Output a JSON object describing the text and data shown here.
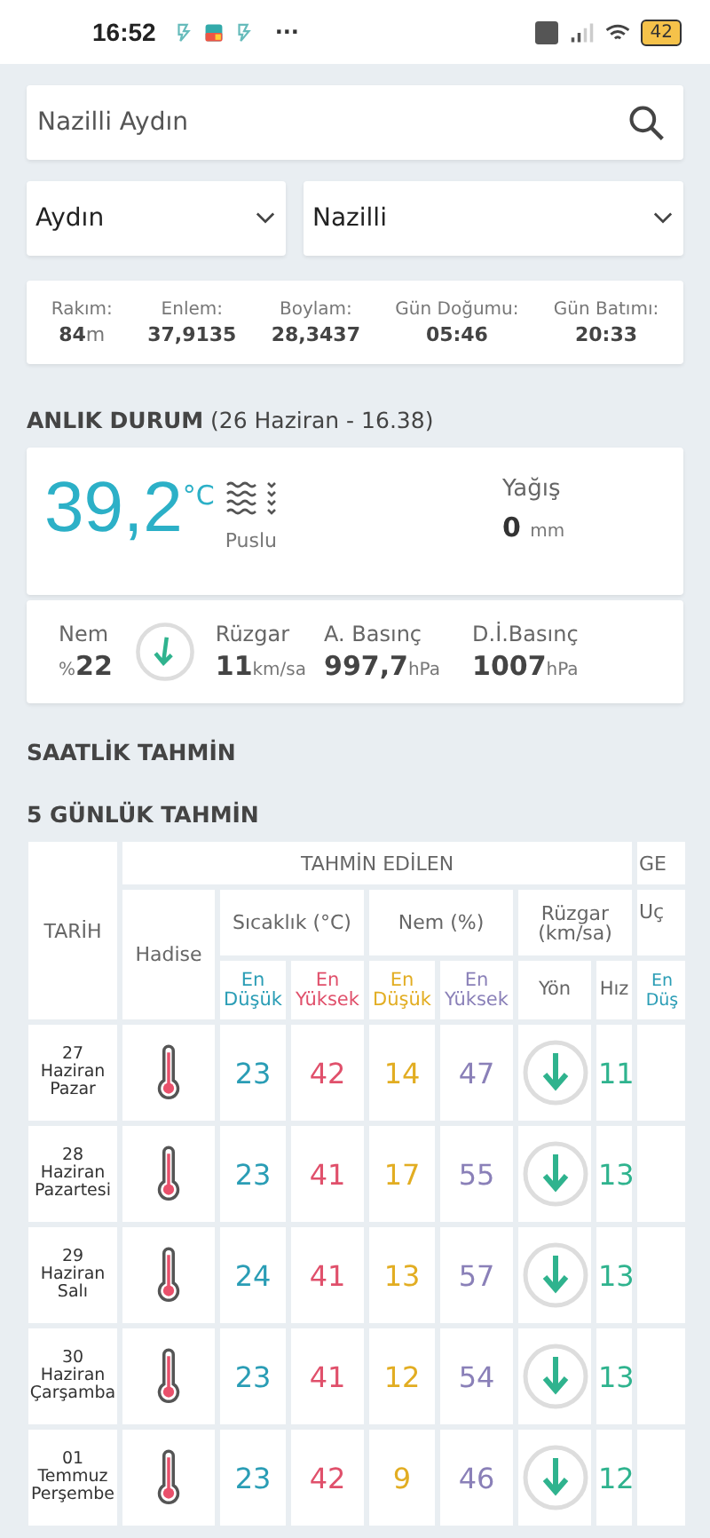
{
  "status_bar": {
    "time": "16:52",
    "more": "···",
    "battery": "42"
  },
  "search": {
    "value": "Nazilli Aydın"
  },
  "selects": [
    {
      "value": "Aydın"
    },
    {
      "value": "Nazilli"
    }
  ],
  "location_info": [
    {
      "label": "Rakım:",
      "value": "84",
      "unit": "m"
    },
    {
      "label": "Enlem:",
      "value": "37,9135"
    },
    {
      "label": "Boylam:",
      "value": "28,3437"
    },
    {
      "label": "Gün Doğumu:",
      "value": "05:46"
    },
    {
      "label": "Gün Batımı:",
      "value": "20:33"
    }
  ],
  "current": {
    "heading": "**ANLIK DURUM** (26 Haziran - 16.38)",
    "temperature": "39,2",
    "temperature_unit": "°C",
    "condition": "Puslu",
    "precip_label": "Yağış",
    "precip_value": "0",
    "precip_unit": "mm",
    "details": [
      {
        "kind": "humidity",
        "label": "Nem",
        "prefix": "%",
        "value": "22"
      },
      {
        "kind": "wind",
        "label": "Rüzgar",
        "value": "11",
        "unit": "km/sa"
      },
      {
        "kind": "pressure",
        "label": "A. Basınç",
        "value": "997,7",
        "unit": "hPa"
      },
      {
        "kind": "pressure",
        "label": "D.İ.Basınç",
        "value": "1007",
        "unit": "hPa"
      }
    ]
  },
  "hourly_heading": "SAATLİK TAHMİN",
  "daily_heading": "5 GÜNLÜK TAHMİN",
  "forecast_table": {
    "date_header": "TARİH",
    "group_header": "TAHMİN EDİLEN",
    "next_group_header": "GE",
    "event_header": "Hadise",
    "temp_header": "Sıcaklık (°C)",
    "humidity_header": "Nem (%)",
    "wind_header": "Rüzgar (km/sa)",
    "next_header": "Uç",
    "sub_headers": [
      {
        "kind": "temp_low",
        "text": "En Düşük"
      },
      {
        "kind": "temp_high",
        "text": "En Yüksek"
      },
      {
        "kind": "hum_low",
        "text": "En Düşük"
      },
      {
        "kind": "hum_high",
        "text": "En Yüksek"
      },
      {
        "kind": "plain",
        "text": "Yön"
      },
      {
        "kind": "plain",
        "text": "Hız"
      },
      {
        "kind": "temp_low",
        "text": "En Düş"
      }
    ],
    "rows": [
      {
        "date": [
          "27",
          "Haziran",
          "Pazar"
        ],
        "temp_low": "23",
        "temp_high": "42",
        "hum_low": "14",
        "hum_high": "47",
        "wind_speed": "11"
      },
      {
        "date": [
          "28",
          "Haziran",
          "Pazartesi"
        ],
        "temp_low": "23",
        "temp_high": "41",
        "hum_low": "17",
        "hum_high": "55",
        "wind_speed": "13"
      },
      {
        "date": [
          "29",
          "Haziran",
          "Salı"
        ],
        "temp_low": "24",
        "temp_high": "41",
        "hum_low": "13",
        "hum_high": "57",
        "wind_speed": "13"
      },
      {
        "date": [
          "30",
          "Haziran",
          "Çarşamba"
        ],
        "temp_low": "23",
        "temp_high": "41",
        "hum_low": "12",
        "hum_high": "54",
        "wind_speed": "13"
      },
      {
        "date": [
          "01",
          "Temmuz",
          "Perşembe"
        ],
        "temp_low": "23",
        "temp_high": "42",
        "hum_low": "9",
        "hum_high": "46",
        "wind_speed": "12"
      }
    ]
  }
}
